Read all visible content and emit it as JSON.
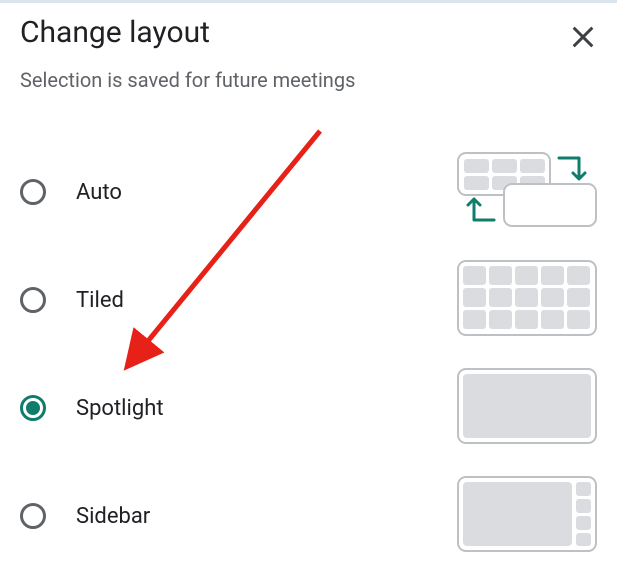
{
  "dialog": {
    "title": "Change layout",
    "subtitle": "Selection is saved for future meetings"
  },
  "options": [
    {
      "id": "auto",
      "label": "Auto",
      "selected": false
    },
    {
      "id": "tiled",
      "label": "Tiled",
      "selected": false
    },
    {
      "id": "spotlight",
      "label": "Spotlight",
      "selected": true
    },
    {
      "id": "sidebar",
      "label": "Sidebar",
      "selected": false
    }
  ],
  "colors": {
    "accent": "#107c6b",
    "tile": "#dadce0",
    "tileBorder": "#bdc1c6",
    "arrow": "#e72117"
  },
  "annotation": {
    "type": "arrow",
    "target": "spotlight"
  }
}
